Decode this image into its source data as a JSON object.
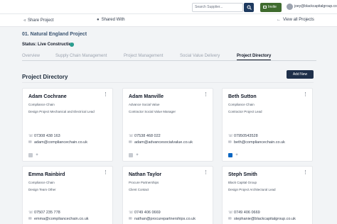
{
  "header": {
    "search_placeholder": "Search Supplier...",
    "invite_label": "Invite",
    "user_email": "joey@blackcapitalgroup.co"
  },
  "actions": {
    "share": "Share Project",
    "shared_with": "Shared With",
    "view_all": "View all Projects"
  },
  "project": {
    "title": "01. Natural England Project",
    "status": "Status: Live Construction",
    "status_color": "#2a9d8f"
  },
  "tabs": [
    "Overview",
    "Supply Chain Management",
    "Project Management",
    "Social Value Delivery",
    "Project Directory"
  ],
  "active_tab": "Project Directory",
  "directory": {
    "title": "Project Directory",
    "add_new": "Add New"
  },
  "contacts": [
    {
      "name": "Adam Cochrane",
      "org": "Compliance Chain",
      "role": "Design Project Mechanical and Electrical Lead",
      "phone": "07308 438 163",
      "email": "adam@compliancechain.co.uk",
      "linkedin_active": false
    },
    {
      "name": "Adam Manville",
      "org": "Advance Social Value",
      "role": "Contractor Social Value Manager",
      "phone": "07538 468 022",
      "email": "adam@advancesocialvalue.co.uk",
      "linkedin_active": false
    },
    {
      "name": "Beth Sutton",
      "org": "Compliance Chain",
      "role": "Contractor Project Lead",
      "phone": "07950543528",
      "email": "beth@compliancechain.co.uk",
      "linkedin_active": true
    },
    {
      "name": "Emma Rainbird",
      "org": "Compliance Chain",
      "role": "Design Team Other",
      "phone": "07507 235 778",
      "email": "emma@compliancechain.co.uk"
    },
    {
      "name": "Nathan Taylor",
      "org": "Procure Partnerships",
      "role": "Client Contact",
      "phone": "0749 406 0669",
      "email": "nathan@procurepartnerships.co.uk"
    },
    {
      "name": "Steph Smith",
      "org": "Black Capital Group",
      "role": "Design Project Architectural Lead",
      "phone": "0749 406 0669",
      "email": "stephanie@blackcapitalgroup.co.uk"
    }
  ],
  "icons": {
    "share": "share-icon",
    "shared_with": "users-icon",
    "view_all": "arrow-left-icon",
    "phone": "phone-icon",
    "email": "mail-icon",
    "menu": "kebab-menu-icon"
  }
}
